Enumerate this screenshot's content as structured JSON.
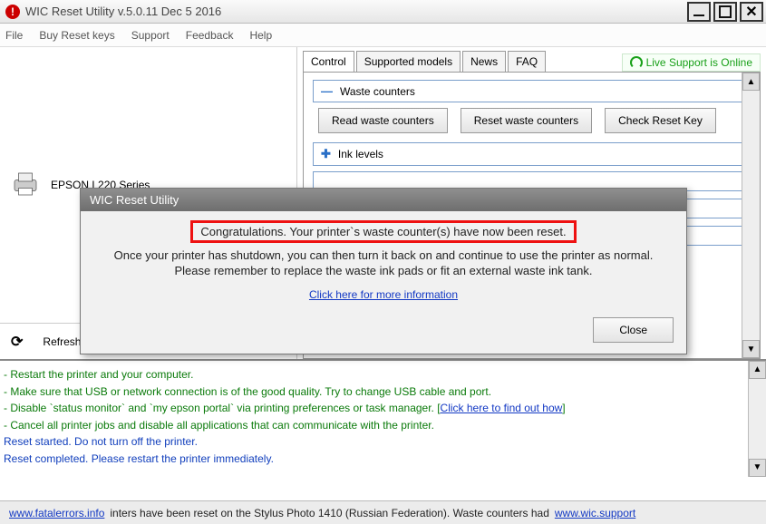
{
  "titlebar": {
    "app_icon_glyph": "!",
    "title": "WIC Reset Utility v.5.0.11 Dec  5 2016"
  },
  "menu": {
    "items": [
      "File",
      "Buy Reset keys",
      "Support",
      "Feedback",
      "Help"
    ]
  },
  "left": {
    "printer_name": "EPSON L220 Series",
    "refresh_label": "Refresh detected printers list"
  },
  "tabs": {
    "items": [
      "Control",
      "Supported models",
      "News",
      "FAQ"
    ],
    "active": 0
  },
  "live_support": "Live Support is Online",
  "control": {
    "waste_section": "Waste counters",
    "buttons": {
      "read": "Read waste counters",
      "reset": "Reset waste counters",
      "check_key": "Check Reset Key"
    },
    "ink_section": "Ink levels"
  },
  "dialog": {
    "title": "WIC Reset Utility",
    "headline": "Congratulations. Your printer`s waste counter(s) have now been reset.",
    "line1": "Once your printer has shutdown, you can then turn it back on and continue to use the printer as normal.",
    "line2": "Please remember to replace the waste ink pads or fit an external waste ink tank.",
    "link": "Click here for more information",
    "close": "Close"
  },
  "log": {
    "l1": "- Restart the printer and your computer.",
    "l2": "- Make sure that USB or network connection is of the good quality. Try to change USB cable and port.",
    "l3a": "- Disable `status monitor` and `my epson portal` via printing preferences or task manager. [",
    "l3link": "Click here to find out how",
    "l3b": "]",
    "l4": "- Cancel all printer jobs and disable all applications that can communicate with the printer.",
    "l5": "Reset started. Do not turn off the printer.",
    "l6": "Reset completed. Please restart the printer immediately."
  },
  "statusbar": {
    "link1": "www.fatalerrors.info",
    "mid": "inters have been reset on the Stylus Photo 1410 (Russian Federation).  Waste counters had",
    "link2": "www.wic.support"
  }
}
